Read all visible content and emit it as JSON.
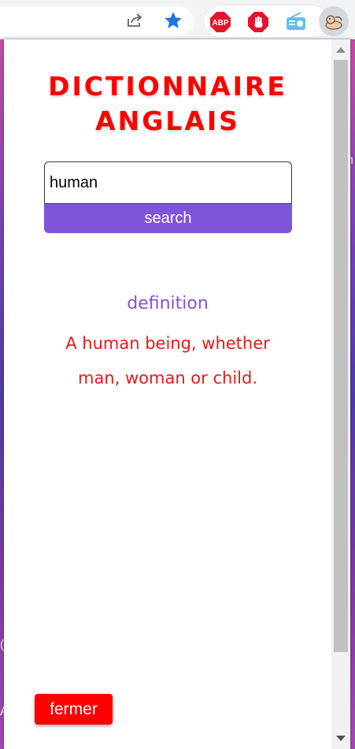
{
  "popup": {
    "title_line1": "DICTIONNAIRE",
    "title_line2": "ANGLAIS",
    "search_value": "human",
    "search_button_label": "search",
    "definition_label": "definition",
    "definition_text": "A human being, whether man, woman or child.",
    "close_button_label": "fermer"
  },
  "toolbar": {
    "extensions": {
      "abp_label": "ABP"
    }
  },
  "icons": {
    "share": "share-icon",
    "bookmark": "star-icon",
    "adblock": "abp-icon",
    "stop": "stop-hand-icon",
    "radio": "radio-icon",
    "profile": "avatar-icon"
  },
  "colors": {
    "title": "#ff0000",
    "accent": "#7e55d9",
    "definition": "#e8191c",
    "close_button": "#ff0000",
    "star": "#1a73e8"
  }
}
